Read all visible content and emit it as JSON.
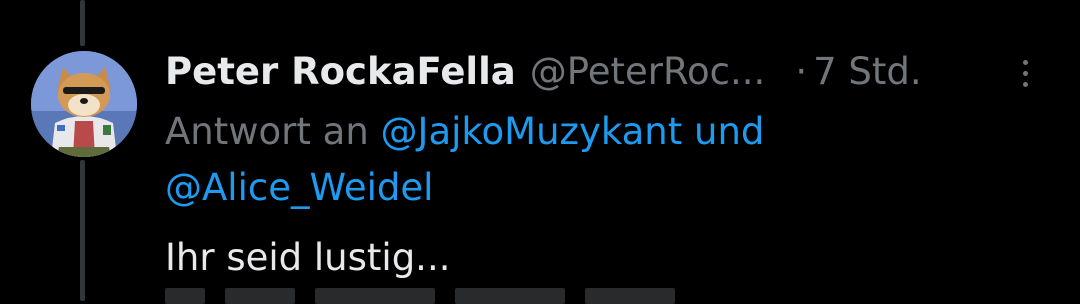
{
  "tweet": {
    "author": {
      "display_name": "Peter RockaFella",
      "handle": "@PeterRoc...",
      "avatar_icon": "shiba-dog-avatar-icon"
    },
    "separator": "·",
    "time": "7 Std.",
    "reply_prefix": "Antwort an",
    "mentions": [
      "@JajkoMuzykant",
      "@Alice_Weidel"
    ],
    "mention_joiner": "und",
    "text": "Ihr seid lustig..."
  },
  "menu": {
    "icon": "more-vertical-icon"
  },
  "colors": {
    "background": "#000000",
    "primary_text": "#e7e9ea",
    "secondary_text": "#71767b",
    "link": "#1d9bf0",
    "thread_line": "#333639"
  }
}
